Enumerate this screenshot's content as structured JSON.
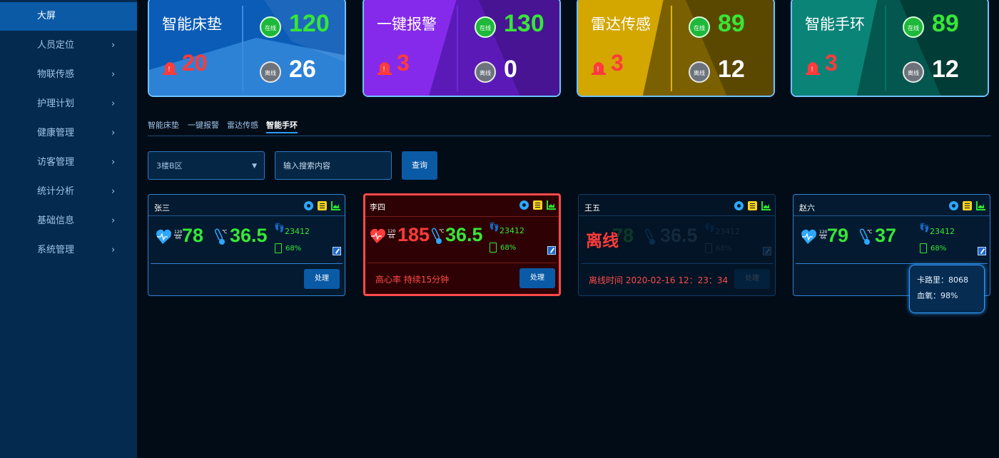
{
  "sidebar": {
    "items": [
      {
        "label": "大屏",
        "active": true
      },
      {
        "label": "人员定位",
        "chev": "›"
      },
      {
        "label": "物联传感",
        "chev": "›"
      },
      {
        "label": "护理计划",
        "chev": "›"
      },
      {
        "label": "健康管理",
        "chev": "›"
      },
      {
        "label": "访客管理",
        "chev": "›"
      },
      {
        "label": "统计分析",
        "chev": "›"
      },
      {
        "label": "基础信息",
        "chev": "›"
      },
      {
        "label": "系统管理",
        "chev": "›"
      }
    ]
  },
  "stats": [
    {
      "title": "智能床垫",
      "alarm": "20",
      "online": "120",
      "offline": "26",
      "online_label": "在线",
      "offline_label": "离线",
      "bg": "#0a5cb7",
      "accent": "#4aa3f0",
      "divider": "#3d8be0"
    },
    {
      "title": "一键报警",
      "alarm": "3",
      "online": "130",
      "offline": "0",
      "online_label": "在线",
      "offline_label": "离线",
      "bg": "#5b1ab8",
      "accent": "#8a2cf0",
      "divider": "#6b2ad8"
    },
    {
      "title": "雷达传感",
      "alarm": "3",
      "online": "89",
      "offline": "12",
      "online_label": "在线",
      "offline_label": "离线",
      "bg": "#7a6000",
      "accent": "#d8aa00",
      "divider": "#e2b300"
    },
    {
      "title": "智能手环",
      "alarm": "3",
      "online": "89",
      "offline": "12",
      "online_label": "在线",
      "offline_label": "离线",
      "bg": "#03574f",
      "accent": "#0c8a7c",
      "divider": "#0d6f64"
    }
  ],
  "tabs": [
    "智能床垫",
    "一键报警",
    "雷达传感",
    "智能手环"
  ],
  "active_tab": "智能手环",
  "filters": {
    "area": "3楼B区",
    "search_placeholder": "输入搜索内容",
    "query_label": "查询"
  },
  "devices": [
    {
      "name": "张三",
      "bp_top": "120",
      "bp_bottom": "66",
      "heart_rate": "78",
      "temp": "36.5",
      "steps": "23412",
      "battery": "68%",
      "status": "normal",
      "button": "处理",
      "note": ""
    },
    {
      "name": "李四",
      "bp_top": "120",
      "bp_bottom": "66",
      "heart_rate": "185",
      "temp": "36.5",
      "steps": "23412",
      "battery": "68%",
      "status": "alarm",
      "button": "处理",
      "note": "高心率  持续15分钟"
    },
    {
      "name": "王五",
      "bp_top": "120",
      "bp_bottom": "66",
      "heart_rate": "78",
      "temp": "36.5",
      "steps": "23412",
      "battery": "68%",
      "status": "offline",
      "button": "处理",
      "offline_label": "离线",
      "note": "离线时间  2020-02-16  12：23：34"
    },
    {
      "name": "赵六",
      "bp_top": "120",
      "bp_bottom": "66",
      "heart_rate": "79",
      "temp": "37",
      "steps": "23412",
      "battery": "68%",
      "status": "normal",
      "button": "",
      "note": ""
    }
  ],
  "tooltip": {
    "calories": "卡路里：8068",
    "oxygen": "血氧：98%"
  },
  "colors": {
    "green": "#37e637",
    "red": "#ff3b3b",
    "blue": "#0a5aa6"
  }
}
